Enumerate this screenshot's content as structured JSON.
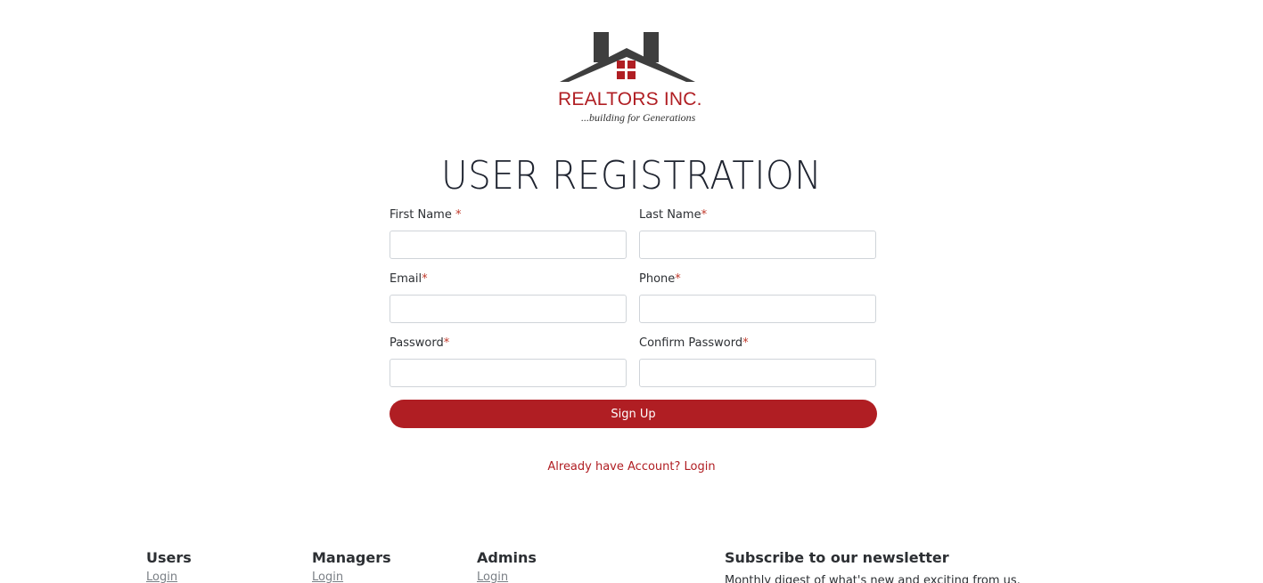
{
  "brand": {
    "name": "REALTORS INC.",
    "tagline": "...building for Generations",
    "primary_color": "#b01e23",
    "roof_color": "#3e3e3e"
  },
  "page": {
    "title": "USER REGISTRATION"
  },
  "form": {
    "required_marker": "*",
    "first_name_label": "First Name ",
    "last_name_label": "Last Name",
    "email_label": "Email",
    "phone_label": "Phone",
    "password_label": "Password",
    "confirm_password_label": "Confirm Password",
    "first_name_value": "",
    "last_name_value": "",
    "email_value": "",
    "phone_value": "",
    "password_value": "",
    "confirm_password_value": "",
    "submit_label": "Sign Up"
  },
  "login_link": "Already have Account? Login",
  "footer": {
    "users": {
      "heading": "Users",
      "link": "Login"
    },
    "managers": {
      "heading": "Managers",
      "link": "Login"
    },
    "admins": {
      "heading": "Admins",
      "link": "Login"
    },
    "newsletter": {
      "heading": "Subscribe to our newsletter",
      "text": "Monthly digest of what's new and exciting from us."
    }
  }
}
